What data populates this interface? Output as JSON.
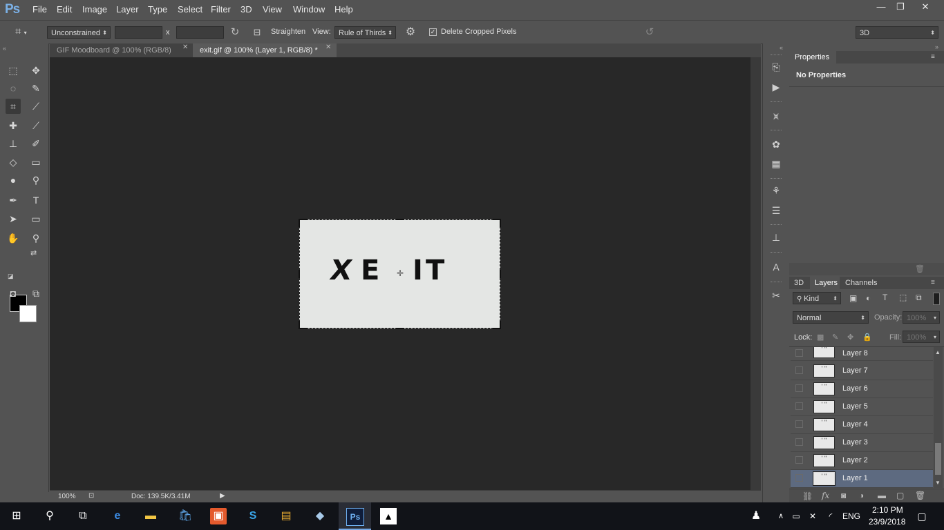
{
  "app": {
    "logo": "Ps"
  },
  "menu": [
    "File",
    "Edit",
    "Image",
    "Layer",
    "Type",
    "Select",
    "Filter",
    "3D",
    "View",
    "Window",
    "Help"
  ],
  "window_controls": {
    "minimize": "—",
    "restore": "❐",
    "close": "✕"
  },
  "options": {
    "ratio_value": "Unconstrained",
    "x_separator": "x",
    "straighten_label": "Straighten",
    "view_label": "View:",
    "view_value": "Rule of Thirds",
    "delete_cropped_label": "Delete Cropped Pixels",
    "delete_cropped_checked": true,
    "workspace_value": "3D"
  },
  "tabs": [
    {
      "label": "GIF Moodboard @ 100% (RGB/8)",
      "active": false
    },
    {
      "label": "exit.gif @ 100% (Layer 1, RGB/8) *",
      "active": true
    }
  ],
  "canvas": {
    "letters": [
      "X",
      "E",
      "I",
      "T"
    ]
  },
  "status": {
    "zoom": "100%",
    "doc": "Doc: 139.5K/3.41M"
  },
  "properties": {
    "title": "Properties",
    "content": "No Properties"
  },
  "layers_panel": {
    "tabs": [
      "3D",
      "Layers",
      "Channels"
    ],
    "active_tab": "Layers",
    "filter_kind": "Kind",
    "blend_mode": "Normal",
    "opacity_label": "Opacity:",
    "opacity_value": "100%",
    "lock_label": "Lock:",
    "fill_label": "Fill:",
    "fill_value": "100%",
    "layers": [
      {
        "name": "Layer 8",
        "selected": false
      },
      {
        "name": "Layer 7",
        "selected": false
      },
      {
        "name": "Layer 6",
        "selected": false
      },
      {
        "name": "Layer 5",
        "selected": false
      },
      {
        "name": "Layer 4",
        "selected": false
      },
      {
        "name": "Layer 3",
        "selected": false
      },
      {
        "name": "Layer 2",
        "selected": false
      },
      {
        "name": "Layer 1",
        "selected": true
      }
    ]
  },
  "taskbar": {
    "language": "ENG",
    "time": "2:10 PM",
    "date": "23/9/2018"
  }
}
